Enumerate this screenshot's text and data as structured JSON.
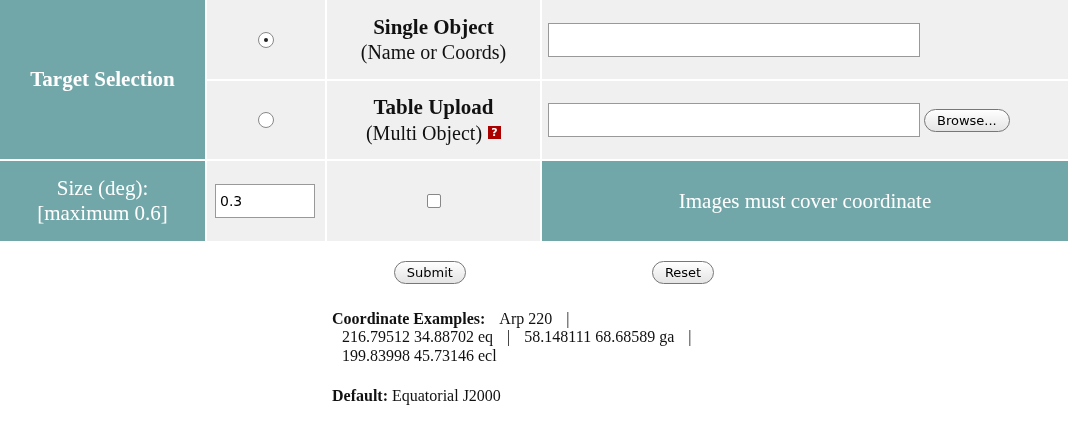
{
  "target_selection": {
    "label": "Target Selection",
    "options": [
      {
        "title": "Single Object",
        "subtitle": "(Name or Coords)",
        "selected": true,
        "kind": "text"
      },
      {
        "title": "Table Upload",
        "subtitle": "(Multi Object)",
        "selected": false,
        "kind": "file",
        "help": "?",
        "browse": "Browse..."
      }
    ]
  },
  "size": {
    "label": "Size (deg):",
    "sublabel": "[maximum 0.6]",
    "value": "0.3",
    "cover_checked": false,
    "cover_label": "Images must cover coordinate"
  },
  "buttons": [
    "Submit",
    "Reset"
  ],
  "examples": [
    [
      {
        "text": "Coordinate Examples:",
        "kind": "label"
      },
      {
        "text": "Arp 220",
        "kind": "value"
      },
      {
        "text": "|",
        "kind": "sep"
      }
    ],
    [
      {
        "text": "216.79512 34.88702 eq",
        "kind": "value"
      },
      {
        "text": "|",
        "kind": "sep"
      },
      {
        "text": "58.148111 68.68589 ga",
        "kind": "value"
      },
      {
        "text": "|",
        "kind": "sep"
      }
    ],
    [
      {
        "text": "199.83998 45.73146 ecl",
        "kind": "value"
      }
    ]
  ],
  "default": {
    "label": "Default:",
    "value": "Equatorial J2000"
  }
}
